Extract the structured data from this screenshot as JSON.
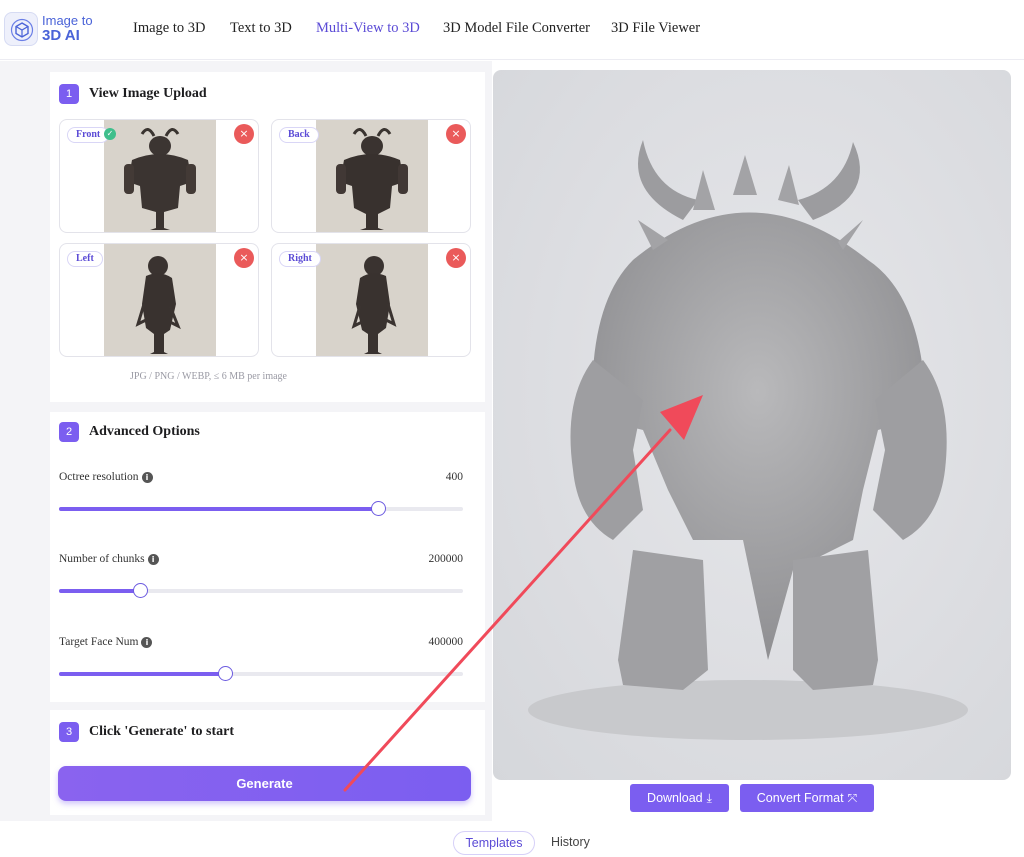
{
  "brand": {
    "line1": "Image to",
    "line2": "3D AI"
  },
  "nav": {
    "items": [
      "Image to 3D",
      "Text to 3D",
      "Multi-View to 3D",
      "3D Model File Converter",
      "3D File Viewer"
    ],
    "active_index": 2
  },
  "upload": {
    "step": "1",
    "title": "View Image Upload",
    "views": [
      {
        "label": "Front",
        "uploaded": true
      },
      {
        "label": "Back"
      },
      {
        "label": "Left"
      },
      {
        "label": "Right"
      }
    ],
    "hint": "JPG / PNG / WEBP, ≤ 6 MB per image",
    "delete_icon": "×",
    "ok_icon": "✓"
  },
  "advanced": {
    "step": "2",
    "title": "Advanced Options",
    "info_icon": "i",
    "options": [
      {
        "label": "Octree resolution",
        "value": "400",
        "fraction": 0.79
      },
      {
        "label": "Number of chunks",
        "value": "200000",
        "fraction": 0.2
      },
      {
        "label": "Target Face Num",
        "value": "400000",
        "fraction": 0.41
      }
    ]
  },
  "generate": {
    "step": "3",
    "title": "Click 'Generate' to start",
    "button_label": "Generate"
  },
  "viewer": {
    "download_label": "Download",
    "download_icon": "⤓",
    "convert_label": "Convert Format",
    "convert_icon": "⤧"
  },
  "tabs": {
    "templates": "Templates",
    "history": "History"
  },
  "colors": {
    "accent": "#7b5ef0",
    "annotation_arrow": "#f04a5a",
    "delete": "#ea5a5a"
  }
}
